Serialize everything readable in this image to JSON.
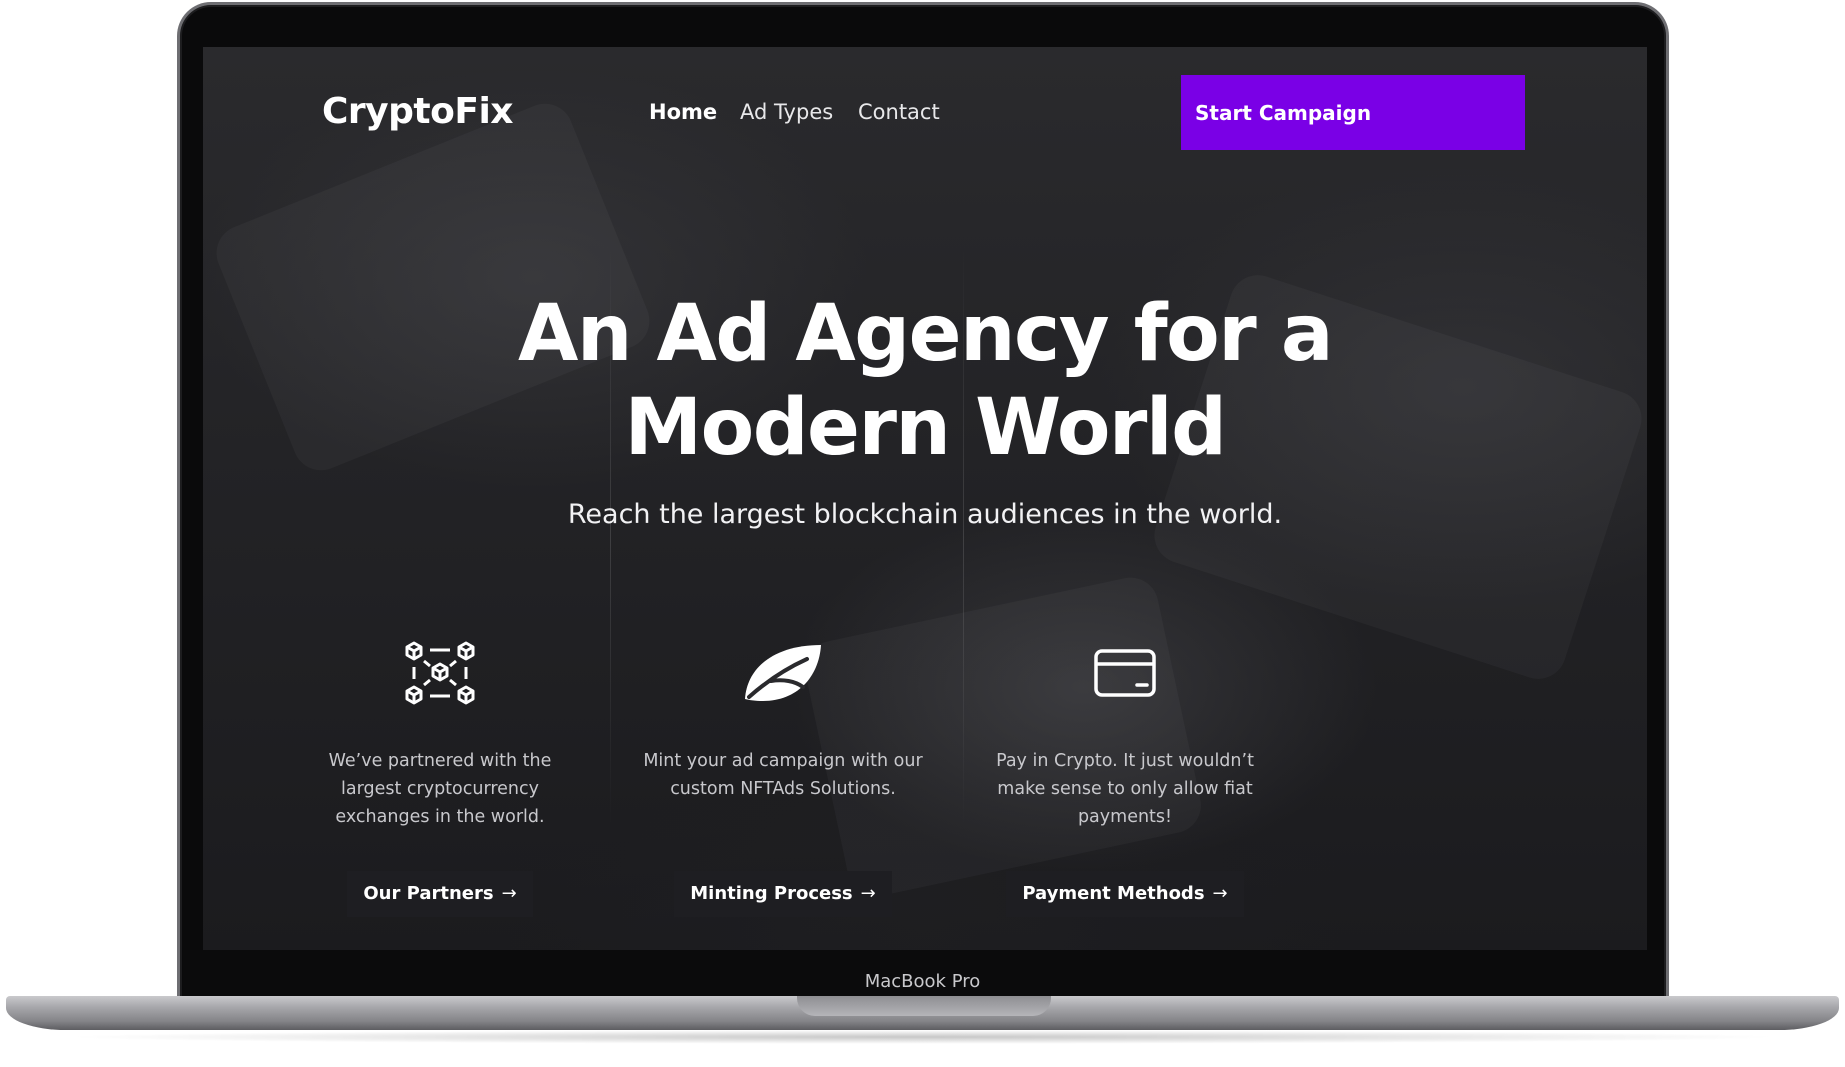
{
  "device": {
    "model_label": "MacBook Pro"
  },
  "site": {
    "logo": "CryptoFix",
    "nav": [
      {
        "label": "Home",
        "active": true
      },
      {
        "label": "Ad Types",
        "active": false
      },
      {
        "label": "Contact",
        "active": false
      }
    ],
    "cta_label": "Start Campaign",
    "accent_color": "#7a00e6"
  },
  "hero": {
    "headline_line1": "An Ad Agency for a",
    "headline_line2": "Modern World",
    "subheadline": "Reach the largest blockchain audiences in the world."
  },
  "features": [
    {
      "icon": "blockchain-network-icon",
      "line1": "We’ve partnered with the",
      "line2": "largest cryptocurrency",
      "line3": "exchanges in the world.",
      "button": "Our Partners",
      "arrow": "→"
    },
    {
      "icon": "leaf-icon",
      "line1": "Mint your ad campaign with our",
      "line2": "custom NFTAds Solutions.",
      "line3": "",
      "button": "Minting Process",
      "arrow": "→"
    },
    {
      "icon": "credit-card-icon",
      "line1": "Pay in Crypto. It just wouldn’t",
      "line2": "make sense to only allow fiat",
      "line3": "payments!",
      "button": "Payment Methods",
      "arrow": "→"
    }
  ]
}
